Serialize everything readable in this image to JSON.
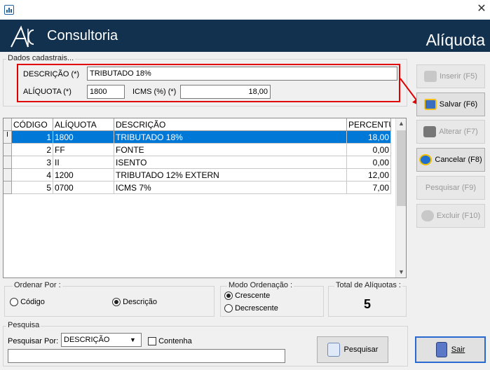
{
  "window": {
    "app_icon": "bar-chart-icon",
    "close_glyph": "✕"
  },
  "header": {
    "brand": "Consultoria",
    "title": "Alíquota",
    "colors": {
      "banner": "#12314e",
      "highlight": "#e00000",
      "selection": "#0078d7"
    }
  },
  "cadastro": {
    "legend": "Dados cadastrais...",
    "descricao_label": "DESCRIÇÃO (*)",
    "descricao_value": "TRIBUTADO 18%",
    "aliquota_label": "ALÍQUOTA (*)",
    "aliquota_value": "1800",
    "icms_label": "ICMS (%) (*)",
    "icms_value": "18,00"
  },
  "grid": {
    "columns": [
      "CÓDIGO",
      "ALÍQUOTA",
      "DESCRIÇÃO",
      "PERCENTU"
    ],
    "current_marker": "I",
    "rows": [
      {
        "codigo": "1",
        "aliquota": "1800",
        "descricao": "TRIBUTADO 18%",
        "percentual": "18,00",
        "selected": true
      },
      {
        "codigo": "2",
        "aliquota": "FF",
        "descricao": "FONTE",
        "percentual": "0,00"
      },
      {
        "codigo": "3",
        "aliquota": "II",
        "descricao": "ISENTO",
        "percentual": "0,00"
      },
      {
        "codigo": "4",
        "aliquota": "1200",
        "descricao": "TRIBUTADO 12% EXTERN",
        "percentual": "12,00"
      },
      {
        "codigo": "5",
        "aliquota": "0700",
        "descricao": "ICMS 7%",
        "percentual": "7,00"
      }
    ]
  },
  "actions": {
    "inserir": {
      "label": "Inserir (F5)",
      "enabled": false,
      "icon": "add-icon"
    },
    "salvar": {
      "label": "Salvar (F6)",
      "enabled": true,
      "icon": "save-icon"
    },
    "alterar": {
      "label": "Alterar (F7)",
      "enabled": false,
      "icon": "edit-icon"
    },
    "cancelar": {
      "label": "Cancelar (F8)",
      "enabled": true,
      "icon": "cancel-icon"
    },
    "pesquisar": {
      "label": "Pesquisar (F9)",
      "enabled": false
    },
    "excluir": {
      "label": "Excluir (F10)",
      "enabled": false,
      "icon": "delete-icon"
    }
  },
  "ordenar": {
    "legend": "Ordenar Por :",
    "codigo": "Código",
    "descricao": "Descrição",
    "selected": "descricao"
  },
  "modo": {
    "legend": "Modo Ordenação :",
    "crescente": "Crescente",
    "decrescente": "Decrescente",
    "selected": "crescente"
  },
  "total": {
    "legend": "Total de Alíquotas :",
    "value": "5"
  },
  "pesquisa": {
    "legend": "Pesquisa",
    "por_label": "Pesquisar Por:",
    "por_value": "DESCRIÇÃO",
    "contenha_label": "Contenha",
    "contenha_checked": false,
    "term": "",
    "button": "Pesquisar"
  },
  "sair": {
    "label": "Sair",
    "icon": "exit-door-icon"
  }
}
